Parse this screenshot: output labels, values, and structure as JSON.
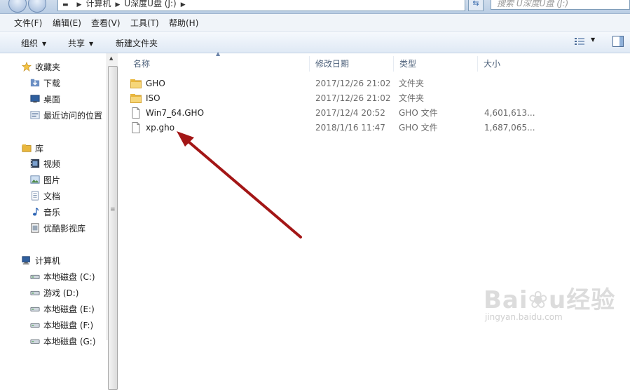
{
  "address": {
    "segments": [
      "计算机",
      "U深度U盘 (J:)"
    ]
  },
  "search": {
    "placeholder": "搜索 U深度U盘 (J:)"
  },
  "menu": [
    "文件(F)",
    "编辑(E)",
    "查看(V)",
    "工具(T)",
    "帮助(H)"
  ],
  "toolbar": {
    "organize": "组织",
    "share": "共享",
    "new_folder": "新建文件夹"
  },
  "nav": {
    "favorites": {
      "label": "收藏夹",
      "items": [
        "下载",
        "桌面",
        "最近访问的位置"
      ]
    },
    "libraries": {
      "label": "库",
      "items": [
        "视频",
        "图片",
        "文档",
        "音乐",
        "优酷影视库"
      ]
    },
    "computer": {
      "label": "计算机",
      "items": [
        "本地磁盘 (C:)",
        "游戏 (D:)",
        "本地磁盘 (E:)",
        "本地磁盘 (F:)",
        "本地磁盘 (G:)"
      ]
    }
  },
  "columns": [
    "名称",
    "修改日期",
    "类型",
    "大小"
  ],
  "files": [
    {
      "name": "GHO",
      "date": "2017/12/26 21:02",
      "type": "文件夹",
      "size": "",
      "kind": "folder"
    },
    {
      "name": "ISO",
      "date": "2017/12/26 21:02",
      "type": "文件夹",
      "size": "",
      "kind": "folder"
    },
    {
      "name": "Win7_64.GHO",
      "date": "2017/12/4 20:52",
      "type": "GHO 文件",
      "size": "4,601,613...",
      "kind": "file"
    },
    {
      "name": "xp.gho",
      "date": "2018/1/16 11:47",
      "type": "GHO 文件",
      "size": "1,687,065...",
      "kind": "file"
    }
  ],
  "watermark": {
    "brand": "Bai",
    "brand2": "经验",
    "url": "jingyan.baidu.com"
  },
  "colors": {
    "arrow": "#a31616",
    "folder": "#e9b73d"
  }
}
